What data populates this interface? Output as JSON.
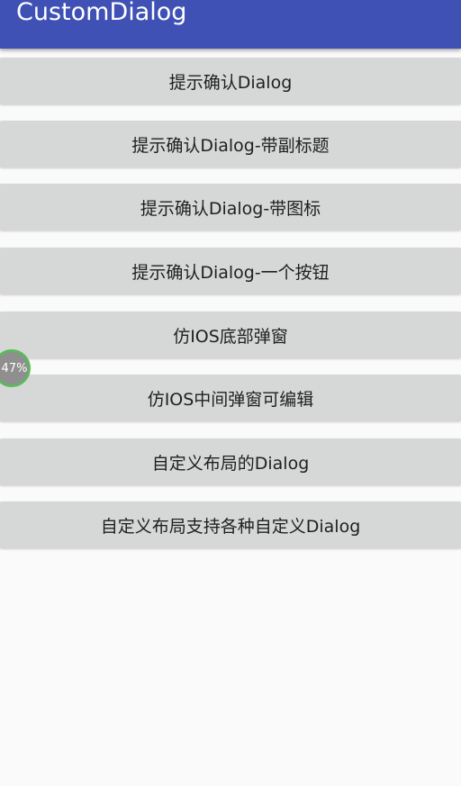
{
  "appbar": {
    "title": "CustomDialog",
    "color": "#3f51b5"
  },
  "buttons": [
    {
      "label": "提示确认Dialog"
    },
    {
      "label": "提示确认Dialog-带副标题"
    },
    {
      "label": "提示确认Dialog-带图标"
    },
    {
      "label": "提示确认Dialog-一个按钮"
    },
    {
      "label": "仿IOS底部弹窗"
    },
    {
      "label": "仿IOS中间弹窗可编辑"
    },
    {
      "label": "自定义布局的Dialog"
    },
    {
      "label": "自定义布局支持各种自定义Dialog"
    }
  ],
  "floating_indicator": {
    "text": "47%",
    "ring_color": "#5cb85c"
  }
}
